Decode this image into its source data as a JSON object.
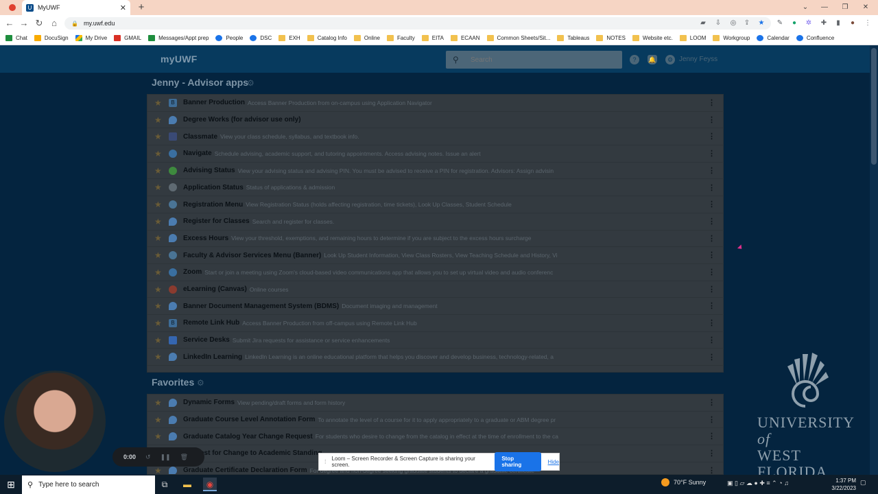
{
  "browser": {
    "tab_title": "MyUWF",
    "url": "my.uwf.edu",
    "bookmarks": [
      {
        "label": "Chat",
        "icon": "green"
      },
      {
        "label": "DocuSign",
        "icon": "yellow"
      },
      {
        "label": "My Drive",
        "icon": "drive"
      },
      {
        "label": "GMAIL",
        "icon": "red"
      },
      {
        "label": "Messages/Appt prep",
        "icon": "green"
      },
      {
        "label": "People",
        "icon": "blue"
      },
      {
        "label": "DSC",
        "icon": "blue"
      },
      {
        "label": "EXH",
        "icon": "folder"
      },
      {
        "label": "Catalog Info",
        "icon": "folder"
      },
      {
        "label": "Online",
        "icon": "folder"
      },
      {
        "label": "Faculty",
        "icon": "folder"
      },
      {
        "label": "EITA",
        "icon": "folder"
      },
      {
        "label": "ECAAN",
        "icon": "folder"
      },
      {
        "label": "Common Sheets/Sit...",
        "icon": "folder"
      },
      {
        "label": "Tableaus",
        "icon": "folder"
      },
      {
        "label": "NOTES",
        "icon": "folder"
      },
      {
        "label": "Website etc.",
        "icon": "folder"
      },
      {
        "label": "LOOM",
        "icon": "folder"
      },
      {
        "label": "Workgroup",
        "icon": "folder"
      },
      {
        "label": "Calendar",
        "icon": "blue"
      },
      {
        "label": "Confluence",
        "icon": "blue"
      }
    ]
  },
  "header": {
    "logo": "myUWF",
    "search_placeholder": "Search",
    "username": "Jenny Feyss"
  },
  "advisor_section": {
    "title": "Jenny - Advisor apps",
    "apps": [
      {
        "name": "Banner Production",
        "desc": "Access Banner Production from on-campus using Application Navigator",
        "icon": "sq",
        "glyph": "B"
      },
      {
        "name": "Degree Works (for advisor use only)",
        "desc": "",
        "icon": "drop",
        "glyph": ""
      },
      {
        "name": "Classmate",
        "desc": "View your class schedule, syllabus, and textbook info.",
        "icon": "book",
        "glyph": ""
      },
      {
        "name": "Navigate",
        "desc": "Schedule advising, academic support, and tutoring appointments. Access advising notes. Issue an alert",
        "icon": "round",
        "glyph": ""
      },
      {
        "name": "Advising Status",
        "desc": "View your advising status and advising PIN. You must be advised to receive a PIN for registration. Advisors: Assign advisin",
        "icon": "green",
        "glyph": ""
      },
      {
        "name": "Application Status",
        "desc": "Status of applications & admission",
        "icon": "gray",
        "glyph": ""
      },
      {
        "name": "Registration Menu",
        "desc": "View Registration Status (holds affecting registration, time tickets), Look Up Classes, Student Schedule",
        "icon": "cloud",
        "glyph": ""
      },
      {
        "name": "Register for Classes",
        "desc": "Search and register for classes.",
        "icon": "drop",
        "glyph": ""
      },
      {
        "name": "Excess Hours",
        "desc": "View your threshold, exemptions, and remaining hours to determine if you are subject to the excess hours surcharge",
        "icon": "drop",
        "glyph": ""
      },
      {
        "name": "Faculty & Advisor Services Menu (Banner)",
        "desc": "Look Up Student Information, View Class Rosters, View Teaching Schedule and History, Vi",
        "icon": "cloud",
        "glyph": ""
      },
      {
        "name": "Zoom",
        "desc": "Start or join a meeting using Zoom's cloud-based video communications app that allows you to set up virtual video and audio conferenc",
        "icon": "round",
        "glyph": ""
      },
      {
        "name": "eLearning (Canvas)",
        "desc": "Online courses",
        "icon": "ring",
        "glyph": ""
      },
      {
        "name": "Banner Document Management System (BDMS)",
        "desc": "Document imaging and management",
        "icon": "drop",
        "glyph": ""
      },
      {
        "name": "Remote Link Hub",
        "desc": "Access Banner Production from off-campus using Remote Link Hub",
        "icon": "sq",
        "glyph": "B"
      },
      {
        "name": "Service Desks",
        "desc": "Submit Jira requests for assistance or service enhancements",
        "icon": "bolt",
        "glyph": ""
      },
      {
        "name": "LinkedIn Learning",
        "desc": "LinkedIn Learning is an online educational platform that helps you discover and develop business, technology-related, a",
        "icon": "drop",
        "glyph": ""
      }
    ]
  },
  "favorites_section": {
    "title": "Favorites",
    "apps": [
      {
        "name": "Dynamic Forms",
        "desc": "View pending/draft forms and form history",
        "icon": "drop"
      },
      {
        "name": "Graduate Course Level Annotation Form",
        "desc": "To annotate the level of a course for it to apply appropriately to a graduate or ABM degree pr",
        "icon": "drop"
      },
      {
        "name": "Graduate Catalog Year Change Request",
        "desc": "For students who desire to change from the catalog in effect at the time of enrollment to the ca",
        "icon": "drop"
      },
      {
        "name": "Request for Change to Academic Standing",
        "desc": "",
        "icon": "drop"
      },
      {
        "name": "Graduate Certificate Declaration Form",
        "desc": "For degree and non-degree seeking graduate students to declare a graduate certificate",
        "icon": "drop"
      }
    ]
  },
  "uwf_logo": {
    "line1": "UNIVERSITY",
    "of": "of",
    "line2": "WEST FLORIDA"
  },
  "loom": {
    "timer": "0:00",
    "share_text": "Loom – Screen Recorder & Screen Capture is sharing your screen.",
    "stop_label": "Stop sharing",
    "hide_label": "Hide"
  },
  "taskbar": {
    "search_placeholder": "Type here to search",
    "weather": "70°F  Sunny",
    "time": "1:37 PM",
    "date": "3/22/2023"
  }
}
